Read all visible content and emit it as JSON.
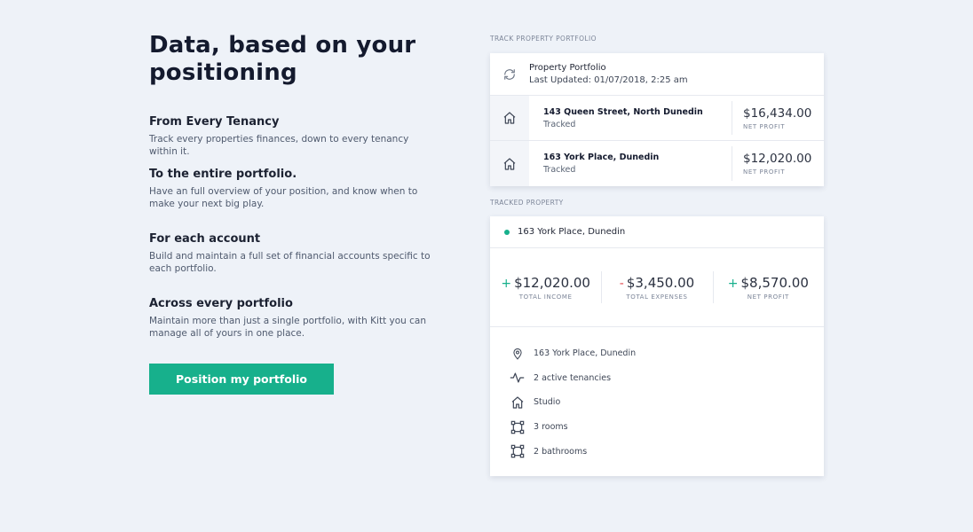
{
  "hero": {
    "headline_line1": "Data, based on your",
    "headline_line2": "positioning"
  },
  "features": [
    {
      "title": "From Every Tenancy",
      "body": "Track every properties finances, down to every tenancy within it."
    },
    {
      "title": "To the entire portfolio.",
      "body": "Have an full overview of your position, and know when to make your next big play."
    },
    {
      "title": "For each account",
      "body": "Build and maintain a full set of financial accounts specific to each portfolio."
    },
    {
      "title": "Across every portfolio",
      "body": "Maintain more than just a single portfolio, with Kitt you can manage all of yours in one place."
    }
  ],
  "cta": {
    "label": "Position my portfolio"
  },
  "portfolio_section": {
    "label": "TRACK PROPERTY PORTFOLIO",
    "title": "Property Portfolio",
    "last_updated": "Last Updated: 01/07/2018, 2:25 am",
    "refresh_icon": "refresh-icon",
    "properties": [
      {
        "address": "143 Queen Street, North Dunedin",
        "status": "Tracked",
        "amount": "$16,434.00",
        "amount_label": "NET PROFIT",
        "icon": "house-icon"
      },
      {
        "address": "163 York Place, Dunedin",
        "status": "Tracked",
        "amount": "$12,020.00",
        "amount_label": "NET PROFIT",
        "icon": "house-icon"
      }
    ]
  },
  "tracked_section": {
    "label": "TRACKED PROPERTY",
    "property_name": "163 York Place, Dunedin",
    "stats": [
      {
        "sign": "+",
        "value": "$12,020.00",
        "label": "TOTAL INCOME",
        "sign_color": "#17b08c"
      },
      {
        "sign": "-",
        "value": "$3,450.00",
        "label": "TOTAL EXPENSES",
        "sign_color": "#e0494f"
      },
      {
        "sign": "+",
        "value": "$8,570.00",
        "label": "NET PROFIT",
        "sign_color": "#17b08c"
      }
    ],
    "details": [
      {
        "icon": "location-pin-icon",
        "text": "163 York Place, Dunedin"
      },
      {
        "icon": "activity-icon",
        "text": "2 active tenancies"
      },
      {
        "icon": "house-icon",
        "text": "Studio"
      },
      {
        "icon": "rooms-icon",
        "text": "3 rooms"
      },
      {
        "icon": "bathrooms-icon",
        "text": "2 bathrooms"
      }
    ]
  },
  "colors": {
    "accent": "#17b08c",
    "negative": "#e0494f",
    "background": "#eef2f8"
  }
}
